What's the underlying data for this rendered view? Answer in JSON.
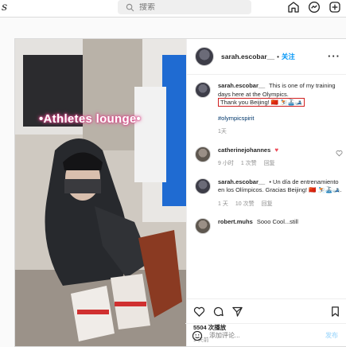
{
  "nav": {
    "logo_fragment": "s",
    "search_placeholder": "搜索"
  },
  "photo": {
    "overlay_text": "•Athletes lounge•"
  },
  "post": {
    "username": "sarah.escobar__",
    "separator": "•",
    "follow_label": "关注",
    "more_label": "···"
  },
  "caption": {
    "username": "sarah.escobar__",
    "text_before": "This is one of my training days here at the Olympics.",
    "highlighted": "Thank you Beijing! 🇨🇳 ⛷️🚠🎿",
    "hashtag": "#olympicspirit",
    "time": "1天"
  },
  "comments": [
    {
      "username": "catherinejohannes",
      "text": "♥",
      "time": "9 小时",
      "likes": "1 次赞",
      "reply": "回复"
    },
    {
      "username": "sarah.escobar__",
      "text": "• Un día de entrenamiento en los Olímpicos. Gracias Beijing! 🇨🇳 ⛷️🚠🎿.",
      "time": "1 天",
      "likes": "10 次赞",
      "reply": "回复"
    },
    {
      "username": "robert.muhs",
      "text": "Sooo Cool...still"
    }
  ],
  "actions": {
    "views": "5504 次播放",
    "date": "1 天前"
  },
  "comment_box": {
    "placeholder": "添加评论...",
    "post_label": "发布"
  },
  "colors": {
    "accent": "#0095f6",
    "highlight_border": "#d02020",
    "overlay_glow": "#e05090"
  }
}
